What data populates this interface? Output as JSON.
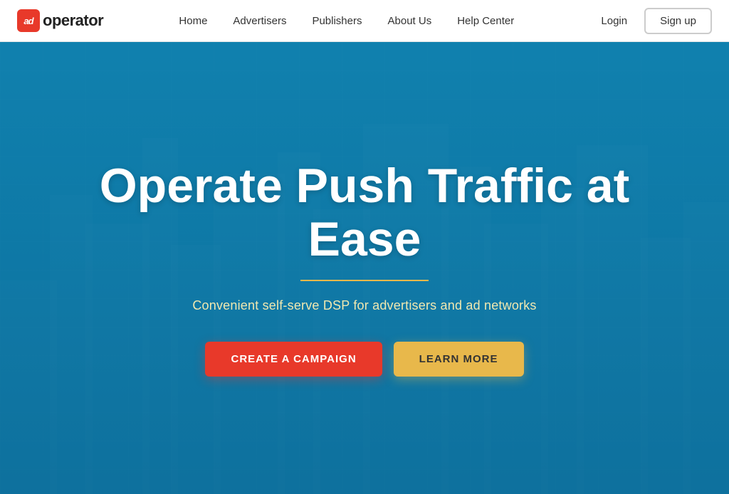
{
  "header": {
    "logo": {
      "icon_text": "ad",
      "text": "operator"
    },
    "nav": {
      "items": [
        {
          "label": "Home",
          "id": "home"
        },
        {
          "label": "Advertisers",
          "id": "advertisers"
        },
        {
          "label": "Publishers",
          "id": "publishers"
        },
        {
          "label": "About Us",
          "id": "about-us"
        },
        {
          "label": "Help Center",
          "id": "help-center"
        }
      ]
    },
    "auth": {
      "login_label": "Login",
      "signup_label": "Sign up"
    }
  },
  "hero": {
    "title": "Operate Push Traffic at Ease",
    "subtitle": "Convenient self-serve DSP for advertisers and ad networks",
    "cta_campaign": "CREATE A CAMPAIGN",
    "cta_learn": "LEARN MORE"
  }
}
